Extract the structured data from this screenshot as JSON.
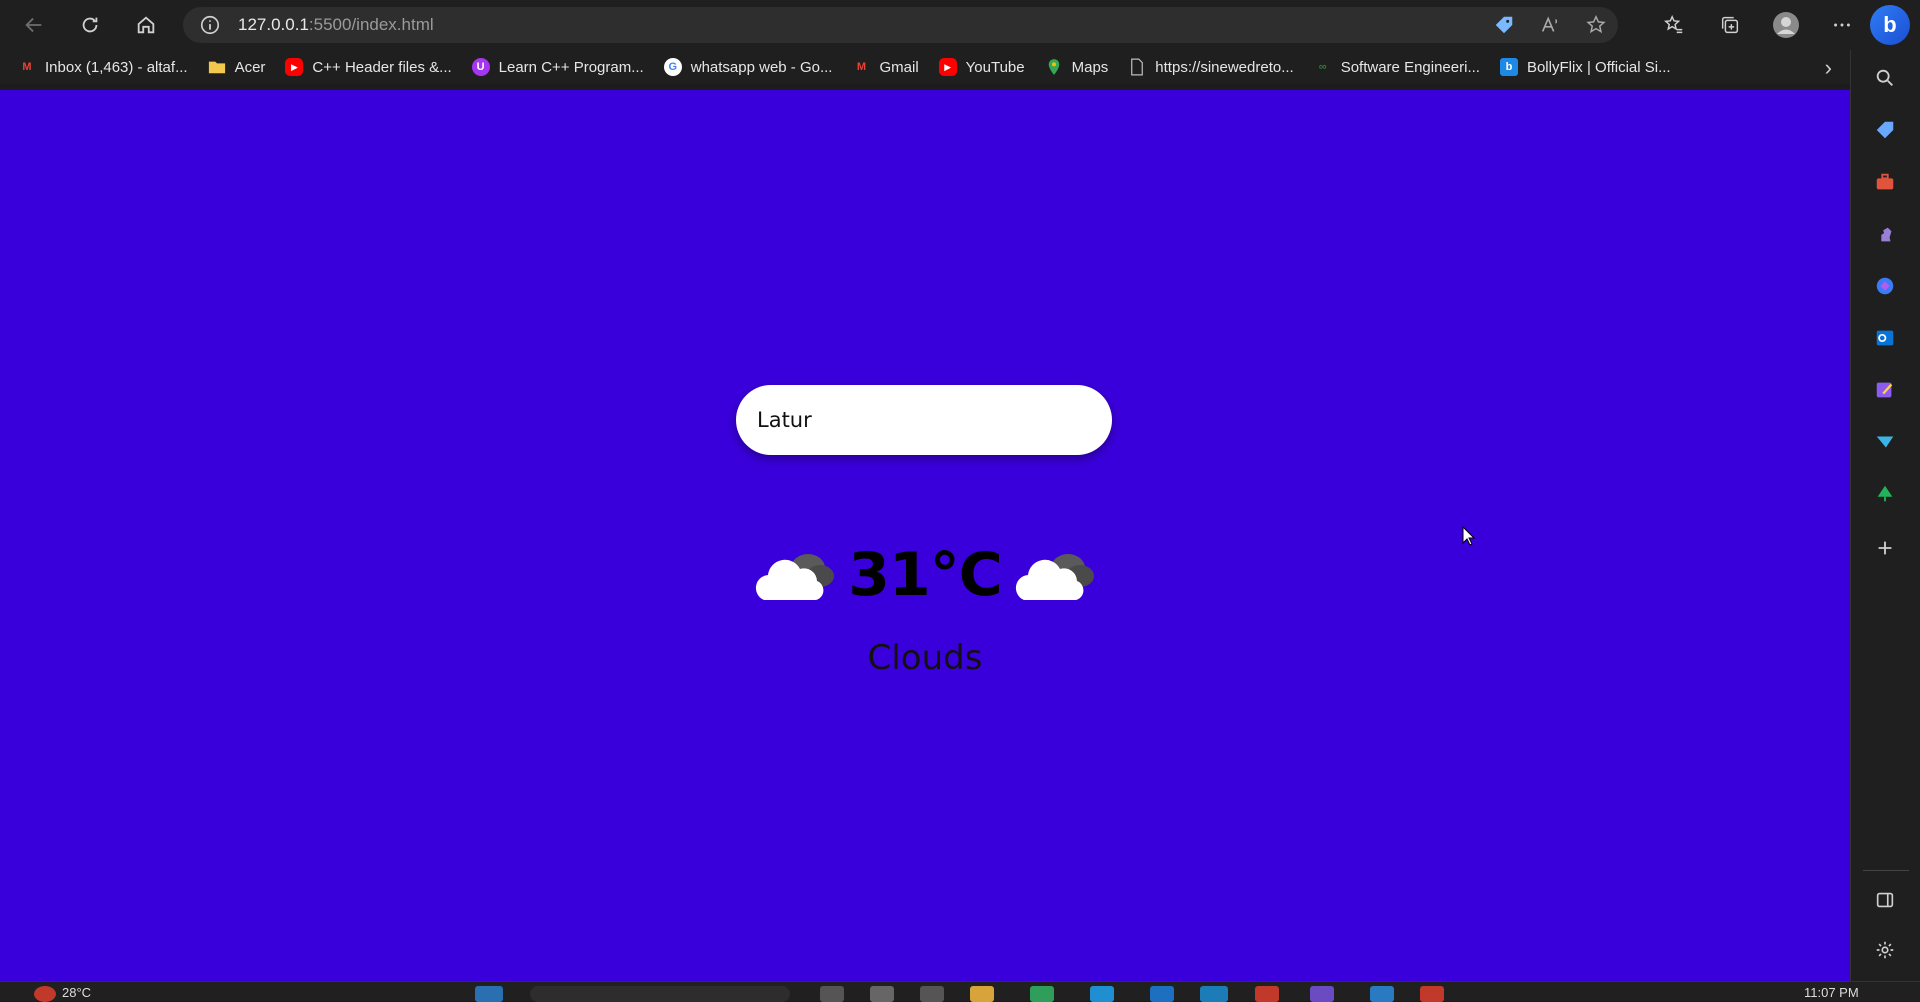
{
  "browser": {
    "url_host": "127.0.0.1",
    "url_path": ":5500/index.html"
  },
  "bookmarks": [
    {
      "label": "Inbox (1,463) - altaf...",
      "icon": "gmail-icon",
      "color": "#ea4335"
    },
    {
      "label": "Acer",
      "icon": "folder-icon",
      "color": "#f2c94c"
    },
    {
      "label": "C++ Header files &...",
      "icon": "youtube-icon",
      "color": "#ff0000"
    },
    {
      "label": "Learn C++ Program...",
      "icon": "udemy-icon",
      "color": "#a435f0"
    },
    {
      "label": "whatsapp web - Go...",
      "icon": "google-icon",
      "color": "#ffffff"
    },
    {
      "label": "Gmail",
      "icon": "gmail-icon",
      "color": "#ea4335"
    },
    {
      "label": "YouTube",
      "icon": "youtube-icon",
      "color": "#ff0000"
    },
    {
      "label": "Maps",
      "icon": "maps-icon",
      "color": "#34a853"
    },
    {
      "label": "https://sinewedreto...",
      "icon": "page-icon",
      "color": "#bdbdbd"
    },
    {
      "label": "Software Engineeri...",
      "icon": "link-icon",
      "color": "#2e7d32"
    },
    {
      "label": "BollyFlix | Official Si...",
      "icon": "bollyflix-icon",
      "color": "#1e88e5"
    }
  ],
  "weather": {
    "city": "Latur",
    "temperature": "31°C",
    "condition": "Clouds"
  },
  "colors": {
    "page_background": "#3a00dc",
    "search_background": "#ffffff"
  },
  "taskbar": {
    "weather_temp": "28°C",
    "clock": "11:07 PM"
  }
}
